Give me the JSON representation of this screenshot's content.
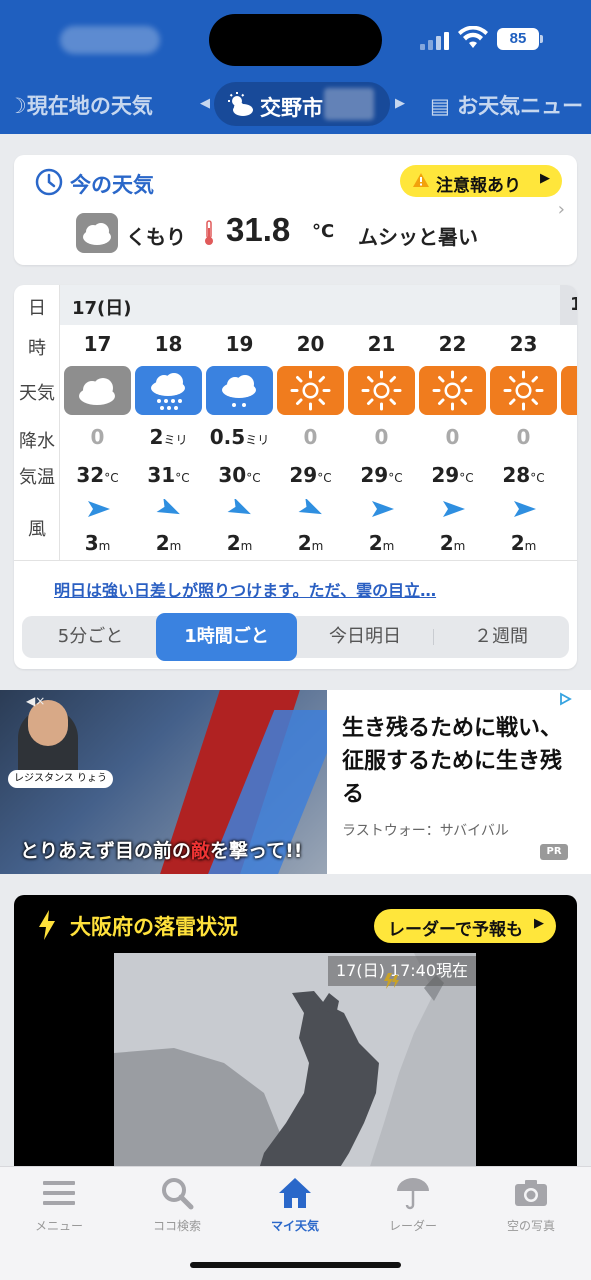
{
  "status": {
    "battery": "85"
  },
  "tabs": {
    "left": "現在地の天気",
    "center": "交野市",
    "right": "お天気ニュー"
  },
  "now": {
    "title": "今の天気",
    "alert": "注意報あり",
    "condition": "くもり",
    "temperature": "31.8",
    "unit": "°C",
    "feel": "ムシッと暑い"
  },
  "hourly": {
    "row_labels": [
      "日",
      "時",
      "天気",
      "降水",
      "気温",
      "風"
    ],
    "day": "17(日)",
    "next_day_partial": "1",
    "hours": [
      {
        "hour": "17",
        "weather": "cloudy",
        "rain": "0",
        "rain_unit": "",
        "temp": "32",
        "temp_unit": "°C",
        "wind": "3",
        "wind_unit": "m",
        "wind_dir": "east"
      },
      {
        "hour": "18",
        "weather": "rain",
        "rain": "2",
        "rain_unit": "ミリ",
        "temp": "31",
        "temp_unit": "°C",
        "wind": "2",
        "wind_unit": "m",
        "wind_dir": "southeast"
      },
      {
        "hour": "19",
        "weather": "light-rain",
        "rain": "0.5",
        "rain_unit": "ミリ",
        "temp": "30",
        "temp_unit": "°C",
        "wind": "2",
        "wind_unit": "m",
        "wind_dir": "southeast"
      },
      {
        "hour": "20",
        "weather": "sunny",
        "rain": "0",
        "rain_unit": "",
        "temp": "29",
        "temp_unit": "°C",
        "wind": "2",
        "wind_unit": "m",
        "wind_dir": "southeast"
      },
      {
        "hour": "21",
        "weather": "sunny",
        "rain": "0",
        "rain_unit": "",
        "temp": "29",
        "temp_unit": "°C",
        "wind": "2",
        "wind_unit": "m",
        "wind_dir": "east"
      },
      {
        "hour": "22",
        "weather": "sunny",
        "rain": "0",
        "rain_unit": "",
        "temp": "29",
        "temp_unit": "°C",
        "wind": "2",
        "wind_unit": "m",
        "wind_dir": "east"
      },
      {
        "hour": "23",
        "weather": "sunny",
        "rain": "0",
        "rain_unit": "",
        "temp": "28",
        "temp_unit": "°C",
        "wind": "2",
        "wind_unit": "m",
        "wind_dir": "east"
      }
    ],
    "link": "明日は強い日差しが照りつけます。ただ、雲の目立…",
    "segments": [
      "5分ごと",
      "1時間ごと",
      "今日明日",
      "２週間"
    ],
    "active_segment": "1時間ごと"
  },
  "ad": {
    "title": "生き残るために戦い、征服するために生き残る",
    "advertiser": "ラストウォー：サバイバル",
    "pr": "PR",
    "image_tag": "レジスタンス りょう",
    "image_caption_pre": "とりあえず目の前の",
    "image_caption_em": "敵",
    "image_caption_post": "を撃って!!"
  },
  "lightning": {
    "title": "大阪府の落雷状況",
    "radar_button": "レーダーで予報も",
    "map_time": "17(日) 17:40現在"
  },
  "bottom_nav": [
    {
      "label": "メニュー",
      "icon": "menu-icon"
    },
    {
      "label": "ココ検索",
      "icon": "search-icon"
    },
    {
      "label": "マイ天気",
      "icon": "home-icon"
    },
    {
      "label": "レーダー",
      "icon": "umbrella-icon"
    },
    {
      "label": "空の写真",
      "icon": "camera-icon"
    }
  ],
  "colors": {
    "brand_blue": "#1f5fbf",
    "sunny_tile": "#f07c1e",
    "rain_tile": "#3a82e0",
    "cloud_tile": "#8e8e8e",
    "alert_yellow": "#ffe63b"
  }
}
